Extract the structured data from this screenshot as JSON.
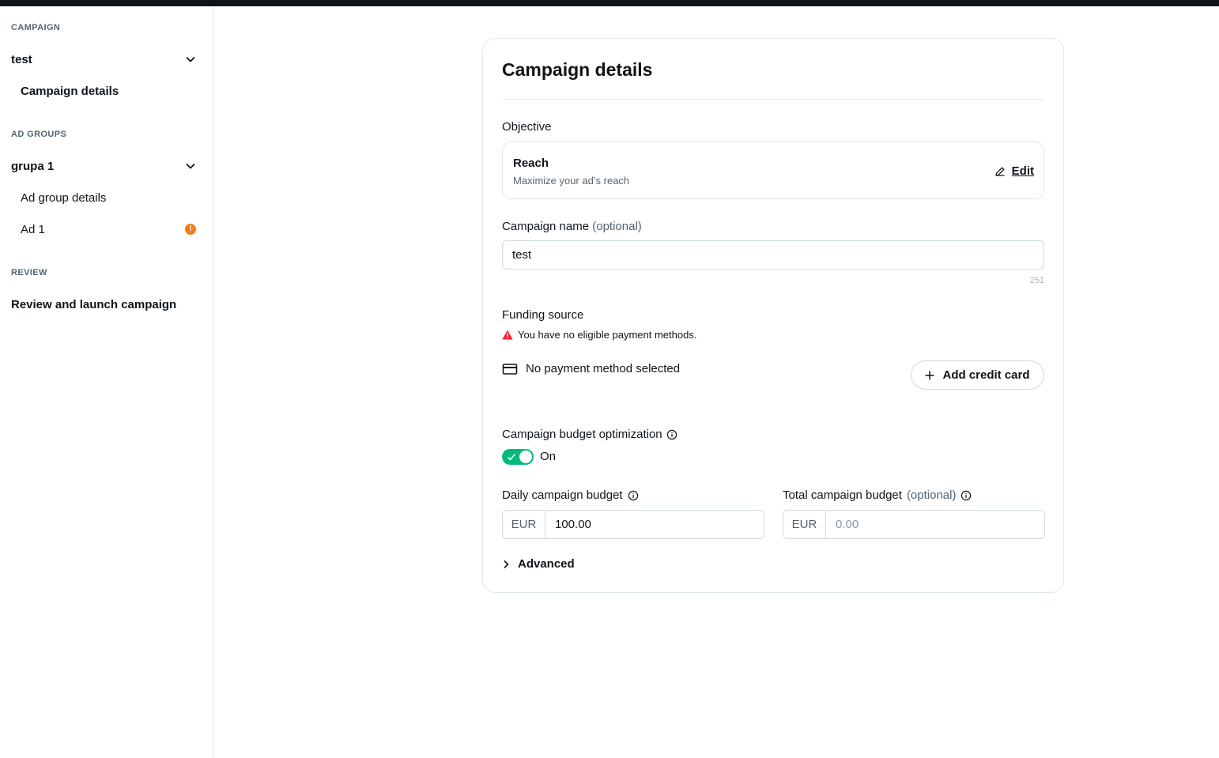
{
  "sidebar": {
    "campaign_section": "CAMPAIGN",
    "campaign_name": "test",
    "campaign_details": "Campaign details",
    "adgroups_section": "AD GROUPS",
    "adgroup_name": "grupa 1",
    "adgroup_details": "Ad group details",
    "ad_name": "Ad 1",
    "ad_warning_glyph": "!",
    "review_section": "REVIEW",
    "review_item": "Review and launch campaign"
  },
  "card": {
    "title": "Campaign details",
    "objective": {
      "label": "Objective",
      "name": "Reach",
      "description": "Maximize your ad’s reach",
      "edit_label": "Edit"
    },
    "campaign_name": {
      "label": "Campaign name",
      "optional": "(optional)",
      "value": "test",
      "char_count": "251"
    },
    "funding": {
      "label": "Funding source",
      "warning": "You have no eligible payment methods.",
      "payment_status": "No payment method selected",
      "add_card_label": "Add credit card"
    },
    "cbo": {
      "label": "Campaign budget optimization",
      "state_text": "On",
      "enabled": true
    },
    "daily_budget": {
      "label": "Daily campaign budget",
      "currency": "EUR",
      "value": "100.00"
    },
    "total_budget": {
      "label": "Total campaign budget",
      "optional": "(optional)",
      "currency": "EUR",
      "placeholder": "0.00"
    },
    "advanced_label": "Advanced"
  },
  "colors": {
    "accent_green": "#00ba7c",
    "warning_orange": "#f07f1b",
    "error_red": "#f4212e",
    "text_primary": "#0f1419",
    "text_secondary": "#536471"
  }
}
